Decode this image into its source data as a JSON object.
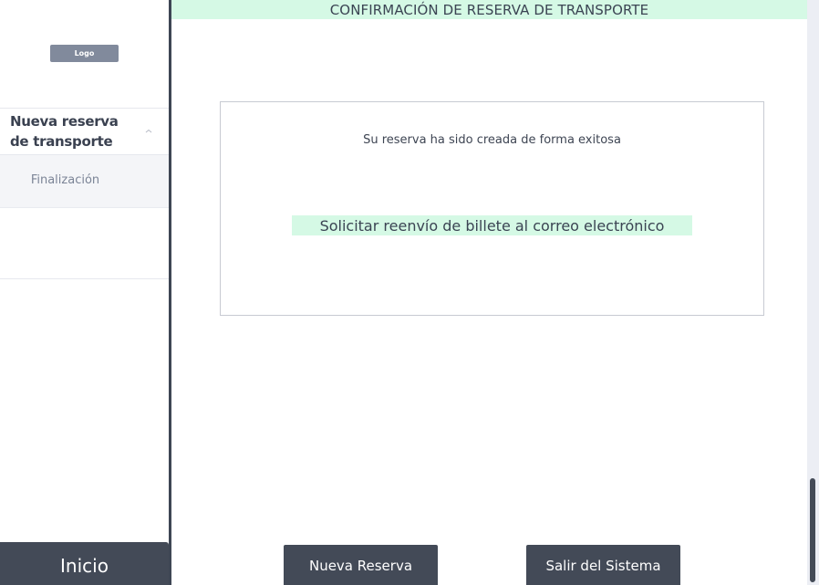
{
  "sidebar": {
    "logo_text": "Logo",
    "menu": {
      "header_label": "Nueva reserva de transporte",
      "header_icon": "chevron-up-icon",
      "items": [
        {
          "label": "Finalización"
        }
      ]
    },
    "home_button_label": "Inicio"
  },
  "main": {
    "title": "CONFIRMACIÓN DE RESERVA DE TRANSPORTE",
    "panel": {
      "message": "Su reserva ha sido creada de forma exitosa",
      "resend_link_label": "Solicitar reenvío de billete al correo electrónico"
    },
    "buttons": {
      "new_booking_label": "Nueva Reserva",
      "exit_label": "Salir del Sistema"
    }
  },
  "colors": {
    "accent_mint": "#d5f9e5",
    "dark_slate": "#434a57",
    "text_primary": "#3b4453",
    "text_muted": "#7b8496"
  }
}
